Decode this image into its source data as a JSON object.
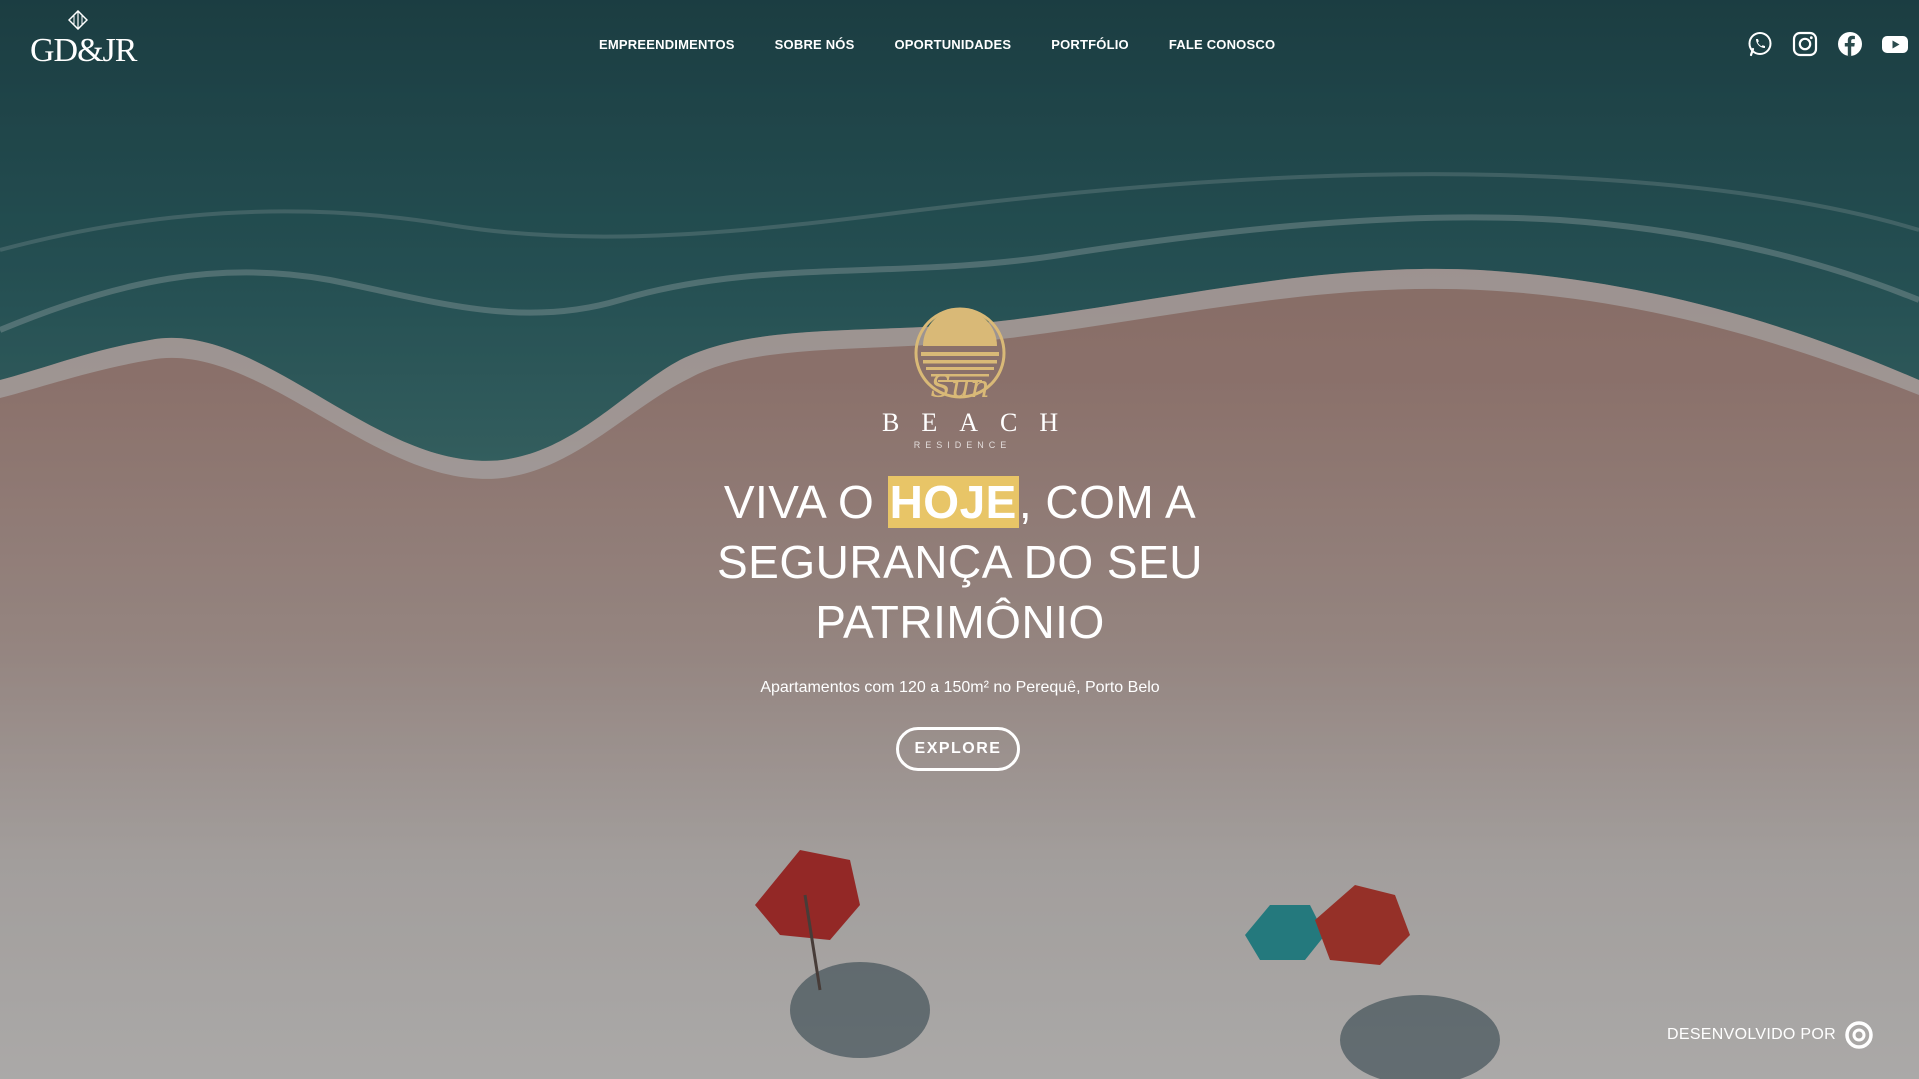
{
  "header": {
    "logo_text": "GD&JR",
    "nav": [
      {
        "label": "EMPREENDIMENTOS"
      },
      {
        "label": "SOBRE NÓS"
      },
      {
        "label": "OPORTUNIDADES"
      },
      {
        "label": "PORTFÓLIO"
      },
      {
        "label": "FALE CONOSCO"
      }
    ],
    "social_icons": [
      "whatsapp-icon",
      "instagram-icon",
      "facebook-icon",
      "youtube-icon"
    ]
  },
  "hero": {
    "brand": {
      "script": "Sun",
      "name": "BEACH",
      "sub": "RESIDENCE"
    },
    "headline": {
      "before": "VIVA O ",
      "highlight": "HOJE",
      "after": ", COM A SEGURANÇA DO SEU PATRIMÔNIO"
    },
    "subtitle": "Apartamentos com 120 a 150m² no Perequê, Porto Belo",
    "cta_label": "EXPLORE"
  },
  "footer": {
    "credit_label": "DESENVOLVIDO POR"
  },
  "colors": {
    "highlight": "#e8c567",
    "brand_gold": "#d9b977",
    "ocean": "#1f5a5c",
    "sand": "#b49086"
  }
}
